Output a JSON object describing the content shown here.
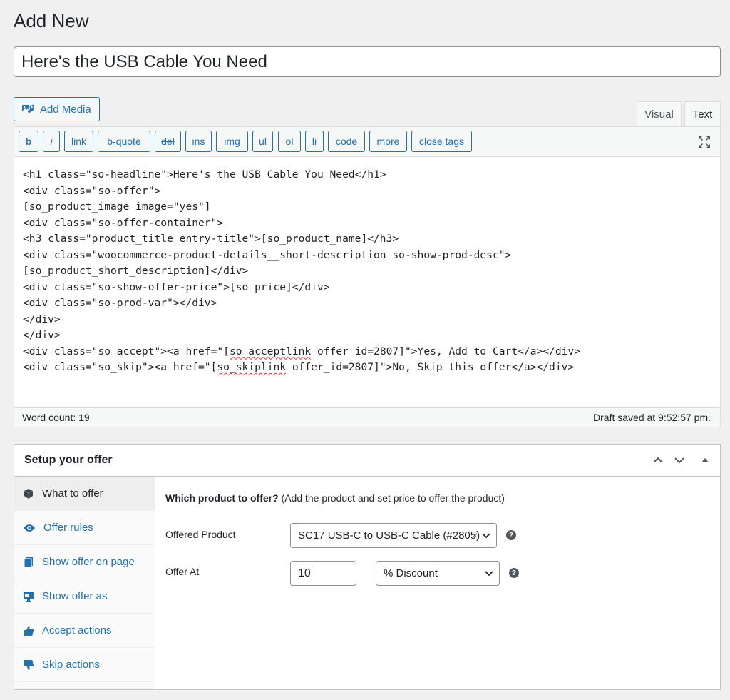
{
  "page": {
    "title": "Add New"
  },
  "post": {
    "title": "Here's the USB Cable You Need"
  },
  "editor": {
    "add_media_label": "Add Media",
    "tabs": [
      "Visual",
      "Text"
    ],
    "toolbar": [
      "b",
      "i",
      "link",
      "b-quote",
      "del",
      "ins",
      "img",
      "ul",
      "ol",
      "li",
      "code",
      "more",
      "close tags"
    ],
    "code_lines": [
      "<h1 class=\"so-headline\">Here's the USB Cable You Need</h1>",
      "<div class=\"so-offer\">",
      "[so_product_image image=\"yes\"]",
      "<div class=\"so-offer-container\">",
      "<h3 class=\"product_title entry-title\">[so_product_name]</h3>",
      "<div class=\"woocommerce-product-details__short-description so-show-prod-desc\">",
      "[so_product_short_description]</div>",
      "<div class=\"so-show-offer-price\">[so_price]</div>",
      "<div class=\"so-prod-var\"></div>",
      "</div>",
      "</div>",
      "<div class=\"so_accept\"><a href=\"[so_acceptlink offer_id=2807]\">Yes, Add to Cart</a></div>",
      "<div class=\"so_skip\"><a href=\"[so_skiplink offer_id=2807]\">No, Skip this offer</a></div>"
    ],
    "word_count": "Word count: 19",
    "draft_saved": "Draft saved at 9:52:57 pm."
  },
  "metabox": {
    "title": "Setup your offer",
    "nav": [
      {
        "label": "What to offer",
        "icon": "cube-icon"
      },
      {
        "label": "Offer rules",
        "icon": "eye-icon"
      },
      {
        "label": "Show offer on page",
        "icon": "pages-icon"
      },
      {
        "label": "Show offer as",
        "icon": "monitor-icon"
      },
      {
        "label": "Accept actions",
        "icon": "thumbs-up-icon"
      },
      {
        "label": "Skip actions",
        "icon": "thumbs-down-icon"
      }
    ],
    "panel": {
      "heading_bold": "Which product to offer?",
      "heading_rest": " (Add the product and set price to offer the product)",
      "offered_product_label": "Offered Product",
      "offered_product_value": "SC17 USB-C to USB-C Cable (#2805)",
      "offer_at_label": "Offer At",
      "offer_at_value": "10",
      "discount_type": "% Discount",
      "help_glyph": "?",
      "clear_glyph": "×"
    }
  }
}
